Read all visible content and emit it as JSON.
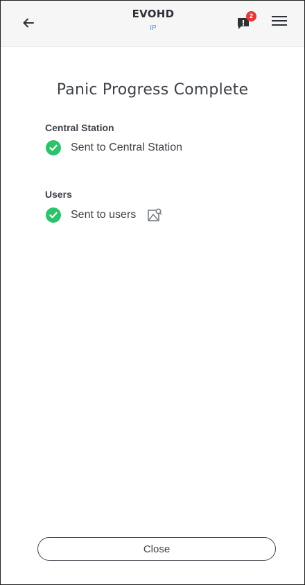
{
  "header": {
    "title": "EVOHD",
    "subtitle": "IP",
    "notification_count": "2",
    "back_icon": "arrow-left-icon",
    "notification_icon": "message-alert-icon",
    "menu_icon": "hamburger-menu-icon"
  },
  "main": {
    "title": "Panic Progress Complete",
    "sections": [
      {
        "label": "Central Station",
        "status": "Sent to Central Station",
        "status_icon": "check-circle-icon"
      },
      {
        "label": "Users",
        "status": "Sent to users",
        "status_icon": "check-circle-icon",
        "extra_icon": "image-icon"
      }
    ]
  },
  "footer": {
    "close_label": "Close"
  },
  "colors": {
    "success": "#2ec26b",
    "badge": "#e53935",
    "accent": "#5a8bd6",
    "text": "#3d4149"
  }
}
